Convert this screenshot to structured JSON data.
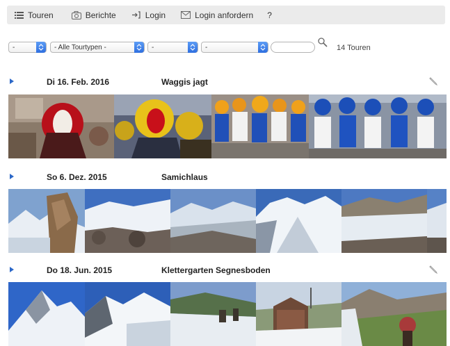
{
  "nav": {
    "items": [
      {
        "id": "touren",
        "label": "Touren",
        "icon": "list-icon"
      },
      {
        "id": "berichte",
        "label": "Berichte",
        "icon": "camera-icon"
      },
      {
        "id": "login",
        "label": "Login",
        "icon": "login-arrow-icon"
      },
      {
        "id": "login_anfordern",
        "label": "Login anfordern",
        "icon": "envelope-icon"
      },
      {
        "id": "help",
        "label": "?",
        "icon": ""
      }
    ]
  },
  "filters": {
    "select_1": "-",
    "select_2": "- Alle Tourtypen -",
    "select_3": "-",
    "select_4": "-",
    "search_value": "",
    "count": "14 Touren"
  },
  "tours": [
    {
      "date": "Di 16. Feb. 2016",
      "name": "Waggis jagt",
      "editable": true
    },
    {
      "date": "So 6. Dez. 2015",
      "name": "Samichlaus",
      "editable": false
    },
    {
      "date": "Do 18. Jun. 2015",
      "name": "Klettergarten Segnesboden",
      "editable": true
    }
  ],
  "colors": {
    "accent_blue": "#2c68c8",
    "nav_bg": "#ebebeb"
  }
}
